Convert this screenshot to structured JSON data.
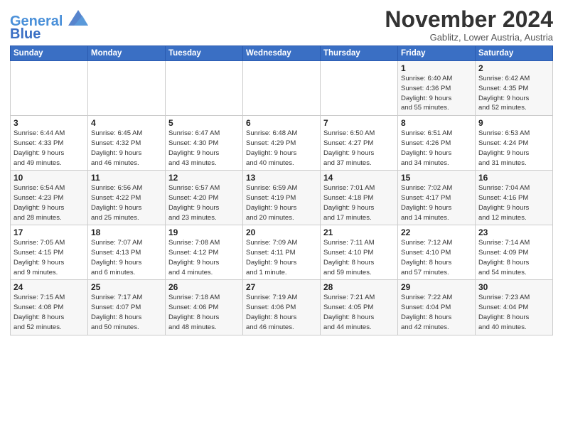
{
  "logo": {
    "line1": "General",
    "line2": "Blue"
  },
  "title": "November 2024",
  "subtitle": "Gablitz, Lower Austria, Austria",
  "days_of_week": [
    "Sunday",
    "Monday",
    "Tuesday",
    "Wednesday",
    "Thursday",
    "Friday",
    "Saturday"
  ],
  "weeks": [
    [
      {
        "day": "",
        "info": ""
      },
      {
        "day": "",
        "info": ""
      },
      {
        "day": "",
        "info": ""
      },
      {
        "day": "",
        "info": ""
      },
      {
        "day": "",
        "info": ""
      },
      {
        "day": "1",
        "info": "Sunrise: 6:40 AM\nSunset: 4:36 PM\nDaylight: 9 hours\nand 55 minutes."
      },
      {
        "day": "2",
        "info": "Sunrise: 6:42 AM\nSunset: 4:35 PM\nDaylight: 9 hours\nand 52 minutes."
      }
    ],
    [
      {
        "day": "3",
        "info": "Sunrise: 6:44 AM\nSunset: 4:33 PM\nDaylight: 9 hours\nand 49 minutes."
      },
      {
        "day": "4",
        "info": "Sunrise: 6:45 AM\nSunset: 4:32 PM\nDaylight: 9 hours\nand 46 minutes."
      },
      {
        "day": "5",
        "info": "Sunrise: 6:47 AM\nSunset: 4:30 PM\nDaylight: 9 hours\nand 43 minutes."
      },
      {
        "day": "6",
        "info": "Sunrise: 6:48 AM\nSunset: 4:29 PM\nDaylight: 9 hours\nand 40 minutes."
      },
      {
        "day": "7",
        "info": "Sunrise: 6:50 AM\nSunset: 4:27 PM\nDaylight: 9 hours\nand 37 minutes."
      },
      {
        "day": "8",
        "info": "Sunrise: 6:51 AM\nSunset: 4:26 PM\nDaylight: 9 hours\nand 34 minutes."
      },
      {
        "day": "9",
        "info": "Sunrise: 6:53 AM\nSunset: 4:24 PM\nDaylight: 9 hours\nand 31 minutes."
      }
    ],
    [
      {
        "day": "10",
        "info": "Sunrise: 6:54 AM\nSunset: 4:23 PM\nDaylight: 9 hours\nand 28 minutes."
      },
      {
        "day": "11",
        "info": "Sunrise: 6:56 AM\nSunset: 4:22 PM\nDaylight: 9 hours\nand 25 minutes."
      },
      {
        "day": "12",
        "info": "Sunrise: 6:57 AM\nSunset: 4:20 PM\nDaylight: 9 hours\nand 23 minutes."
      },
      {
        "day": "13",
        "info": "Sunrise: 6:59 AM\nSunset: 4:19 PM\nDaylight: 9 hours\nand 20 minutes."
      },
      {
        "day": "14",
        "info": "Sunrise: 7:01 AM\nSunset: 4:18 PM\nDaylight: 9 hours\nand 17 minutes."
      },
      {
        "day": "15",
        "info": "Sunrise: 7:02 AM\nSunset: 4:17 PM\nDaylight: 9 hours\nand 14 minutes."
      },
      {
        "day": "16",
        "info": "Sunrise: 7:04 AM\nSunset: 4:16 PM\nDaylight: 9 hours\nand 12 minutes."
      }
    ],
    [
      {
        "day": "17",
        "info": "Sunrise: 7:05 AM\nSunset: 4:15 PM\nDaylight: 9 hours\nand 9 minutes."
      },
      {
        "day": "18",
        "info": "Sunrise: 7:07 AM\nSunset: 4:13 PM\nDaylight: 9 hours\nand 6 minutes."
      },
      {
        "day": "19",
        "info": "Sunrise: 7:08 AM\nSunset: 4:12 PM\nDaylight: 9 hours\nand 4 minutes."
      },
      {
        "day": "20",
        "info": "Sunrise: 7:09 AM\nSunset: 4:11 PM\nDaylight: 9 hours\nand 1 minute."
      },
      {
        "day": "21",
        "info": "Sunrise: 7:11 AM\nSunset: 4:10 PM\nDaylight: 8 hours\nand 59 minutes."
      },
      {
        "day": "22",
        "info": "Sunrise: 7:12 AM\nSunset: 4:10 PM\nDaylight: 8 hours\nand 57 minutes."
      },
      {
        "day": "23",
        "info": "Sunrise: 7:14 AM\nSunset: 4:09 PM\nDaylight: 8 hours\nand 54 minutes."
      }
    ],
    [
      {
        "day": "24",
        "info": "Sunrise: 7:15 AM\nSunset: 4:08 PM\nDaylight: 8 hours\nand 52 minutes."
      },
      {
        "day": "25",
        "info": "Sunrise: 7:17 AM\nSunset: 4:07 PM\nDaylight: 8 hours\nand 50 minutes."
      },
      {
        "day": "26",
        "info": "Sunrise: 7:18 AM\nSunset: 4:06 PM\nDaylight: 8 hours\nand 48 minutes."
      },
      {
        "day": "27",
        "info": "Sunrise: 7:19 AM\nSunset: 4:06 PM\nDaylight: 8 hours\nand 46 minutes."
      },
      {
        "day": "28",
        "info": "Sunrise: 7:21 AM\nSunset: 4:05 PM\nDaylight: 8 hours\nand 44 minutes."
      },
      {
        "day": "29",
        "info": "Sunrise: 7:22 AM\nSunset: 4:04 PM\nDaylight: 8 hours\nand 42 minutes."
      },
      {
        "day": "30",
        "info": "Sunrise: 7:23 AM\nSunset: 4:04 PM\nDaylight: 8 hours\nand 40 minutes."
      }
    ]
  ]
}
